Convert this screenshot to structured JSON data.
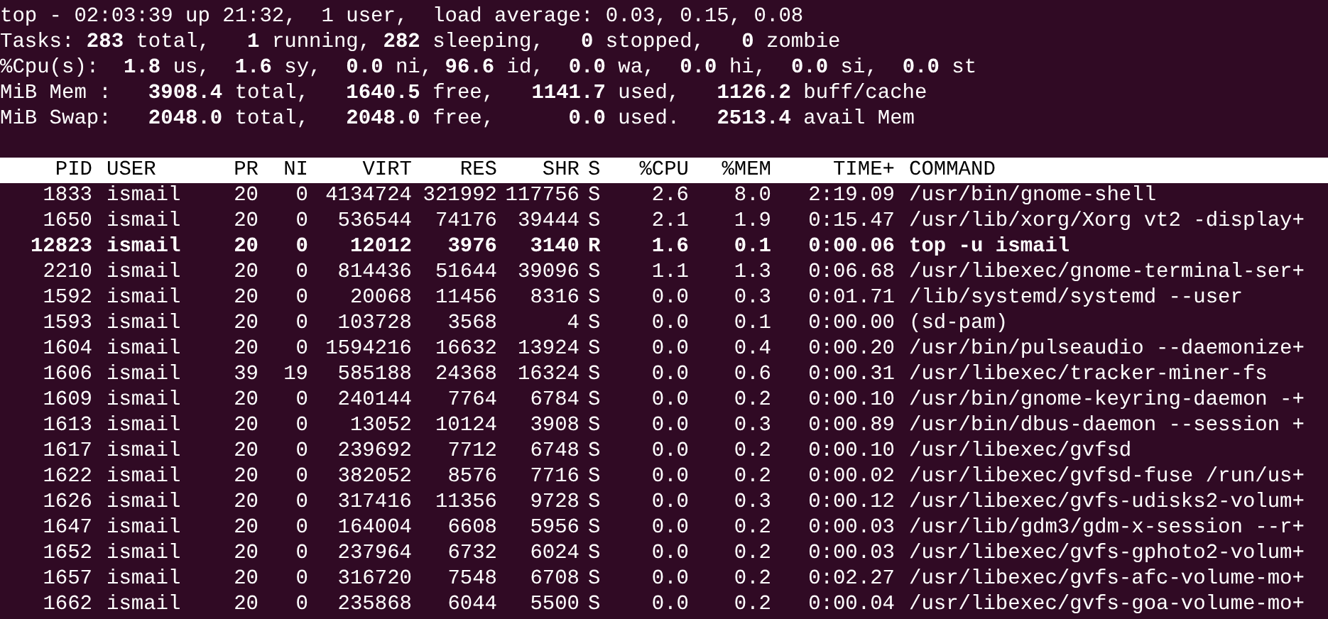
{
  "terminal": {
    "summary": [
      "top - 02:03:39 up 21:32,  1 user,  load average: 0.03, 0.15, 0.08",
      "Tasks: **283** total,   **1** running, **282** sleeping,   **0** stopped,   **0** zombie",
      "%Cpu(s):  **1.8** us,  **1.6** sy,  **0.0** ni, **96.6** id,  **0.0** wa,  **0.0** hi,  **0.0** si,  **0.0** st",
      "MiB Mem :   **3908.4** total,   **1640.5** free,   **1141.7** used,   **1126.2** buff/cache",
      "MiB Swap:   **2048.0** total,   **2048.0** free,      **0.0** used.   **2513.4** avail Mem"
    ],
    "table": {
      "columns": [
        "PID",
        "USER",
        "PR",
        "NI",
        "VIRT",
        "RES",
        "SHR",
        "S",
        "%CPU",
        "%MEM",
        "TIME+",
        "COMMAND"
      ],
      "rows": [
        {
          "cells": [
            "1833",
            "ismail",
            "20",
            "0",
            "4134724",
            "321992",
            "117756",
            "S",
            "2.6",
            "8.0",
            "2:19.09",
            "/usr/bin/gnome-shell"
          ],
          "highlighted": false
        },
        {
          "cells": [
            "1650",
            "ismail",
            "20",
            "0",
            "536544",
            "74176",
            "39444",
            "S",
            "2.1",
            "1.9",
            "0:15.47",
            "/usr/lib/xorg/Xorg vt2 -display+"
          ],
          "highlighted": false
        },
        {
          "cells": [
            "12823",
            "ismail",
            "20",
            "0",
            "12012",
            "3976",
            "3140",
            "R",
            "1.6",
            "0.1",
            "0:00.06",
            "top -u ismail"
          ],
          "highlighted": true
        },
        {
          "cells": [
            "2210",
            "ismail",
            "20",
            "0",
            "814436",
            "51644",
            "39096",
            "S",
            "1.1",
            "1.3",
            "0:06.68",
            "/usr/libexec/gnome-terminal-ser+"
          ],
          "highlighted": false
        },
        {
          "cells": [
            "1592",
            "ismail",
            "20",
            "0",
            "20068",
            "11456",
            "8316",
            "S",
            "0.0",
            "0.3",
            "0:01.71",
            "/lib/systemd/systemd --user"
          ],
          "highlighted": false
        },
        {
          "cells": [
            "1593",
            "ismail",
            "20",
            "0",
            "103728",
            "3568",
            "4",
            "S",
            "0.0",
            "0.1",
            "0:00.00",
            "(sd-pam)"
          ],
          "highlighted": false
        },
        {
          "cells": [
            "1604",
            "ismail",
            "20",
            "0",
            "1594216",
            "16632",
            "13924",
            "S",
            "0.0",
            "0.4",
            "0:00.20",
            "/usr/bin/pulseaudio --daemonize+"
          ],
          "highlighted": false
        },
        {
          "cells": [
            "1606",
            "ismail",
            "39",
            "19",
            "585188",
            "24368",
            "16324",
            "S",
            "0.0",
            "0.6",
            "0:00.31",
            "/usr/libexec/tracker-miner-fs"
          ],
          "highlighted": false
        },
        {
          "cells": [
            "1609",
            "ismail",
            "20",
            "0",
            "240144",
            "7764",
            "6784",
            "S",
            "0.0",
            "0.2",
            "0:00.10",
            "/usr/bin/gnome-keyring-daemon -+"
          ],
          "highlighted": false
        },
        {
          "cells": [
            "1613",
            "ismail",
            "20",
            "0",
            "13052",
            "10124",
            "3908",
            "S",
            "0.0",
            "0.3",
            "0:00.89",
            "/usr/bin/dbus-daemon --session +"
          ],
          "highlighted": false
        },
        {
          "cells": [
            "1617",
            "ismail",
            "20",
            "0",
            "239692",
            "7712",
            "6748",
            "S",
            "0.0",
            "0.2",
            "0:00.10",
            "/usr/libexec/gvfsd"
          ],
          "highlighted": false
        },
        {
          "cells": [
            "1622",
            "ismail",
            "20",
            "0",
            "382052",
            "8576",
            "7716",
            "S",
            "0.0",
            "0.2",
            "0:00.02",
            "/usr/libexec/gvfsd-fuse /run/us+"
          ],
          "highlighted": false
        },
        {
          "cells": [
            "1626",
            "ismail",
            "20",
            "0",
            "317416",
            "11356",
            "9728",
            "S",
            "0.0",
            "0.3",
            "0:00.12",
            "/usr/libexec/gvfs-udisks2-volum+"
          ],
          "highlighted": false
        },
        {
          "cells": [
            "1647",
            "ismail",
            "20",
            "0",
            "164004",
            "6608",
            "5956",
            "S",
            "0.0",
            "0.2",
            "0:00.03",
            "/usr/lib/gdm3/gdm-x-session --r+"
          ],
          "highlighted": false
        },
        {
          "cells": [
            "1652",
            "ismail",
            "20",
            "0",
            "237964",
            "6732",
            "6024",
            "S",
            "0.0",
            "0.2",
            "0:00.03",
            "/usr/libexec/gvfs-gphoto2-volum+"
          ],
          "highlighted": false
        },
        {
          "cells": [
            "1657",
            "ismail",
            "20",
            "0",
            "316720",
            "7548",
            "6708",
            "S",
            "0.0",
            "0.2",
            "0:02.27",
            "/usr/libexec/gvfs-afc-volume-mo+"
          ],
          "highlighted": false
        },
        {
          "cells": [
            "1662",
            "ismail",
            "20",
            "0",
            "235868",
            "6044",
            "5500",
            "S",
            "0.0",
            "0.2",
            "0:00.04",
            "/usr/libexec/gvfs-goa-volume-mo+"
          ],
          "highlighted": false
        }
      ]
    }
  }
}
